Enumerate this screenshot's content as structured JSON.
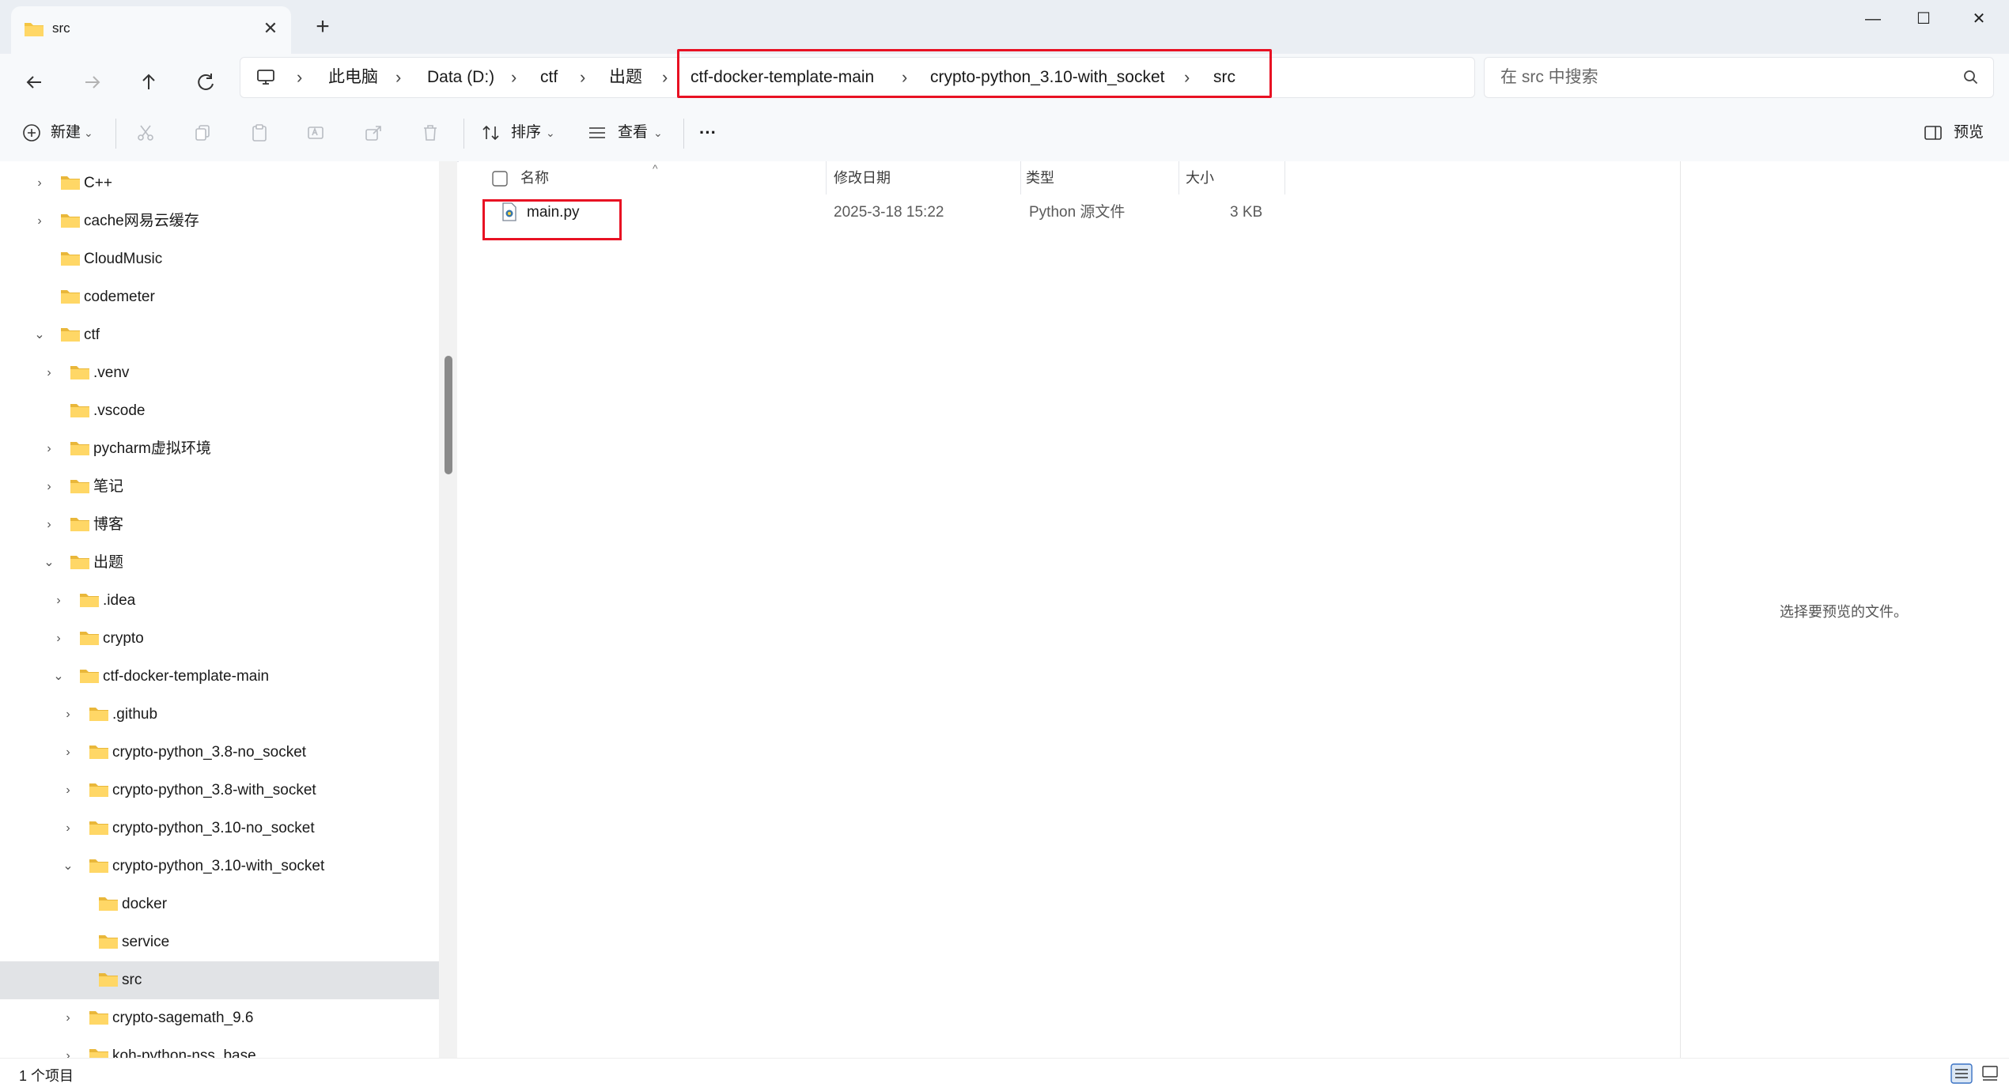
{
  "window": {
    "tab_title": "src",
    "tab_close": "✕",
    "new_tab": "+",
    "min": "—",
    "max": "☐",
    "close": "✕"
  },
  "address": {
    "crumbs": [
      "此电脑",
      "Data (D:)",
      "ctf",
      "出题",
      "ctf-docker-template-main",
      "crypto-python_3.10-with_socket",
      "src"
    ],
    "sep": "›"
  },
  "search": {
    "placeholder": "在 src 中搜索"
  },
  "toolbar": {
    "new_label": "新建",
    "sort_label": "排序",
    "view_label": "查看",
    "more_label": "···",
    "preview_label": "预览"
  },
  "sidebar": {
    "items": [
      {
        "label": "C++",
        "chev": "›"
      },
      {
        "label": "cache网易云缓存",
        "chev": "›"
      },
      {
        "label": "CloudMusic",
        "chev": ""
      },
      {
        "label": "codemeter",
        "chev": ""
      },
      {
        "label": "ctf",
        "chev": "⌄"
      },
      {
        "label": ".venv",
        "chev": "›"
      },
      {
        "label": ".vscode",
        "chev": ""
      },
      {
        "label": "pycharm虚拟环境",
        "chev": "›"
      },
      {
        "label": "笔记",
        "chev": "›"
      },
      {
        "label": "博客",
        "chev": "›"
      },
      {
        "label": "出题",
        "chev": "⌄"
      },
      {
        "label": ".idea",
        "chev": "›"
      },
      {
        "label": "crypto",
        "chev": "›"
      },
      {
        "label": "ctf-docker-template-main",
        "chev": "⌄"
      },
      {
        "label": ".github",
        "chev": "›"
      },
      {
        "label": "crypto-python_3.8-no_socket",
        "chev": "›"
      },
      {
        "label": "crypto-python_3.8-with_socket",
        "chev": "›"
      },
      {
        "label": "crypto-python_3.10-no_socket",
        "chev": "›"
      },
      {
        "label": "crypto-python_3.10-with_socket",
        "chev": "⌄"
      },
      {
        "label": "docker",
        "chev": ""
      },
      {
        "label": "service",
        "chev": ""
      },
      {
        "label": "src",
        "chev": ""
      },
      {
        "label": "crypto-sagemath_9.6",
        "chev": "›"
      },
      {
        "label": "koh-python-nss_base",
        "chev": "›"
      }
    ]
  },
  "columns": {
    "name": "名称",
    "modified": "修改日期",
    "type": "类型",
    "size": "大小"
  },
  "files": [
    {
      "name": "main.py",
      "modified": "2025-3-18 15:22",
      "type": "Python 源文件",
      "size": "3 KB"
    }
  ],
  "preview": {
    "empty_text": "选择要预览的文件。"
  },
  "status": {
    "count": "1 个项目"
  },
  "colors": {
    "highlight": "#e81123",
    "folder": "#f4c542",
    "selected_row": "#e1e3e6"
  }
}
